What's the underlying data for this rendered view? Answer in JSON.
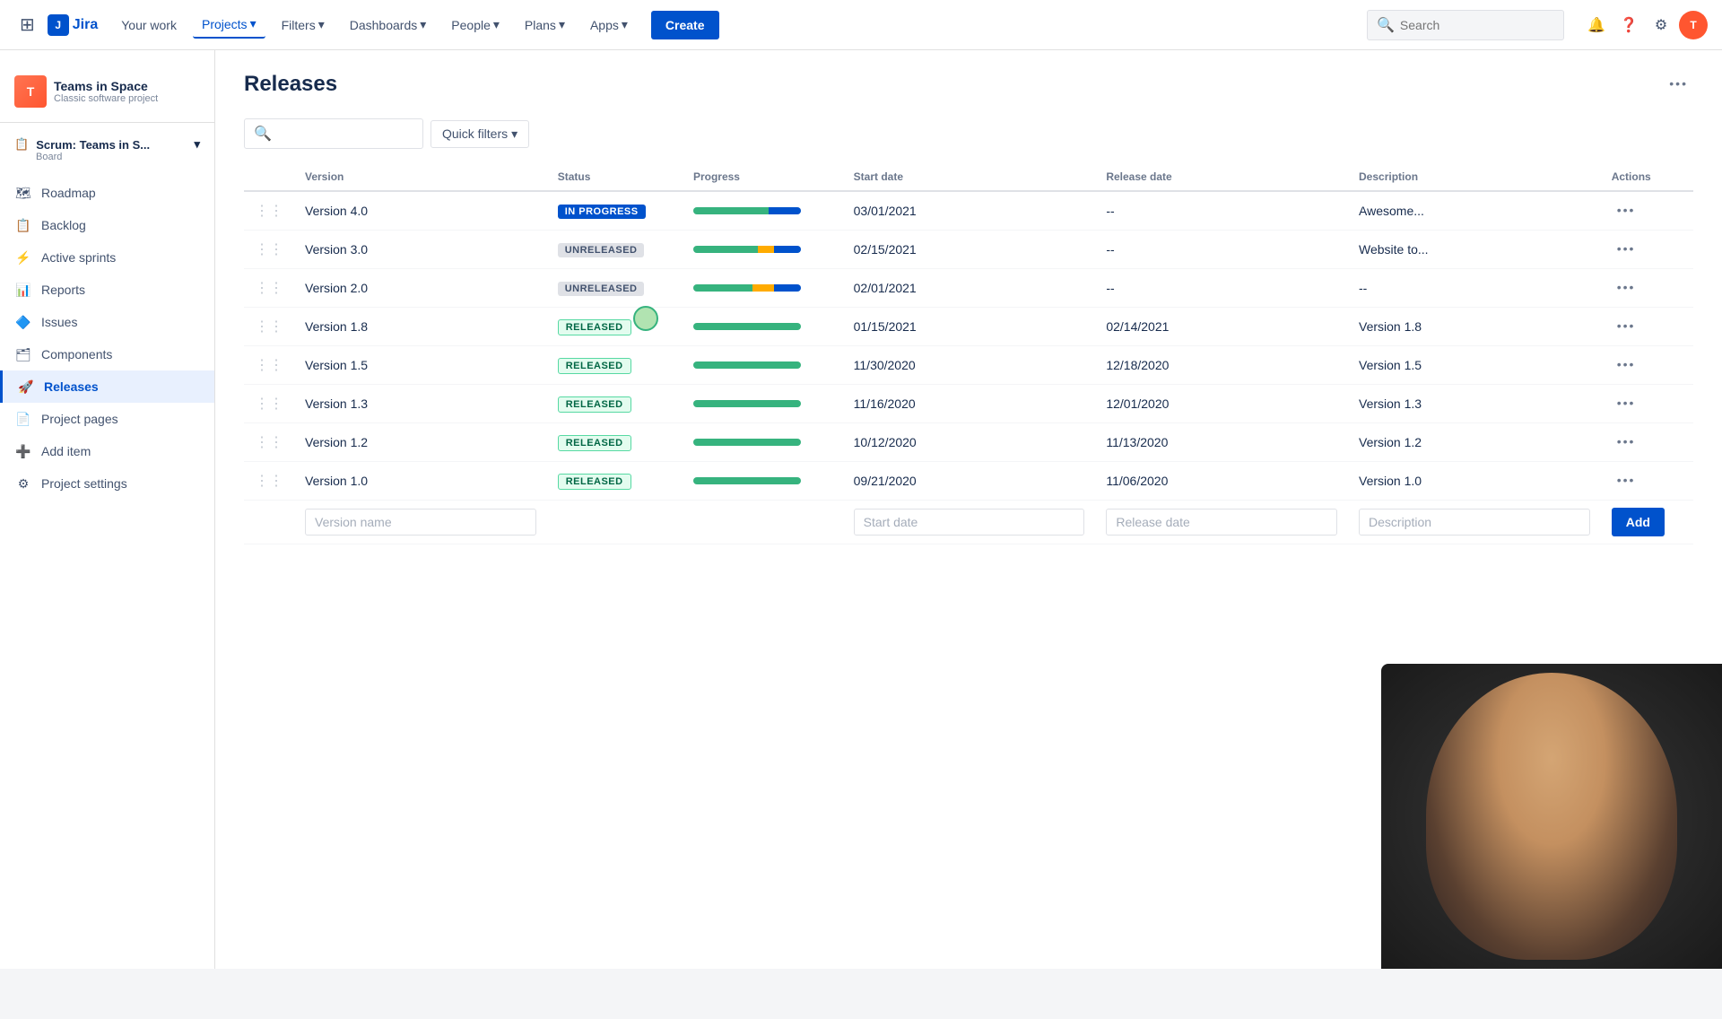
{
  "topnav": {
    "logo_text": "Jira",
    "your_work": "Your work",
    "projects": "Projects",
    "filters": "Filters",
    "dashboards": "Dashboards",
    "people": "People",
    "plans": "Plans",
    "apps": "Apps",
    "create_label": "Create",
    "search_placeholder": "Search"
  },
  "sidebar": {
    "project_name": "Teams in Space",
    "project_type": "Classic software project",
    "board_name": "Scrum: Teams in S...",
    "board_label": "Board",
    "nav_items": [
      {
        "id": "roadmap",
        "label": "Roadmap",
        "icon": "🗺"
      },
      {
        "id": "backlog",
        "label": "Backlog",
        "icon": "📋"
      },
      {
        "id": "active-sprints",
        "label": "Active sprints",
        "icon": "⚡"
      },
      {
        "id": "reports",
        "label": "Reports",
        "icon": "📊"
      },
      {
        "id": "issues",
        "label": "Issues",
        "icon": "🔷"
      },
      {
        "id": "components",
        "label": "Components",
        "icon": "🗂"
      },
      {
        "id": "releases",
        "label": "Releases",
        "icon": "🚀",
        "active": true
      },
      {
        "id": "project-pages",
        "label": "Project pages",
        "icon": "📄"
      },
      {
        "id": "add-item",
        "label": "Add item",
        "icon": "➕"
      },
      {
        "id": "project-settings",
        "label": "Project settings",
        "icon": "⚙"
      }
    ]
  },
  "page": {
    "title": "Releases",
    "table": {
      "columns": [
        "",
        "Version",
        "Status",
        "Progress",
        "Start date",
        "Release date",
        "Description",
        "Actions"
      ],
      "rows": [
        {
          "version": "Version 4.0",
          "status": "IN PROGRESS",
          "status_type": "in-progress",
          "progress": {
            "green": 70,
            "yellow": 0,
            "blue": 30
          },
          "start_date": "03/01/2021",
          "release_date": "--",
          "description": "Awesome..."
        },
        {
          "version": "Version 3.0",
          "status": "UNRELEASED",
          "status_type": "unreleased",
          "progress": {
            "green": 60,
            "yellow": 15,
            "blue": 25
          },
          "start_date": "02/15/2021",
          "release_date": "--",
          "description": "Website to..."
        },
        {
          "version": "Version 2.0",
          "status": "UNRELEASED",
          "status_type": "unreleased",
          "progress": {
            "green": 55,
            "yellow": 20,
            "blue": 25
          },
          "start_date": "02/01/2021",
          "release_date": "--",
          "description": "--"
        },
        {
          "version": "Version 1.8",
          "status": "RELEASED",
          "status_type": "released",
          "progress": {
            "green": 100,
            "yellow": 0,
            "blue": 0
          },
          "start_date": "01/15/2021",
          "release_date": "02/14/2021",
          "description": "Version 1.8"
        },
        {
          "version": "Version 1.5",
          "status": "RELEASED",
          "status_type": "released",
          "progress": {
            "green": 100,
            "yellow": 0,
            "blue": 0
          },
          "start_date": "11/30/2020",
          "release_date": "12/18/2020",
          "description": "Version 1.5"
        },
        {
          "version": "Version 1.3",
          "status": "RELEASED",
          "status_type": "released",
          "progress": {
            "green": 100,
            "yellow": 0,
            "blue": 0
          },
          "start_date": "11/16/2020",
          "release_date": "12/01/2020",
          "description": "Version 1.3"
        },
        {
          "version": "Version 1.2",
          "status": "RELEASED",
          "status_type": "released",
          "progress": {
            "green": 100,
            "yellow": 0,
            "blue": 0
          },
          "start_date": "10/12/2020",
          "release_date": "11/13/2020",
          "description": "Version 1.2"
        },
        {
          "version": "Version 1.0",
          "status": "RELEASED",
          "status_type": "released",
          "progress": {
            "green": 100,
            "yellow": 0,
            "blue": 0
          },
          "start_date": "09/21/2020",
          "release_date": "11/06/2020",
          "description": "Version 1.0"
        }
      ]
    },
    "add_form": {
      "version_placeholder": "Version name",
      "start_date_placeholder": "Start date",
      "release_date_placeholder": "Release date",
      "description_placeholder": "Description",
      "add_button": "Add"
    },
    "quick_filters_label": "Quick filters",
    "more_options_label": "···"
  }
}
